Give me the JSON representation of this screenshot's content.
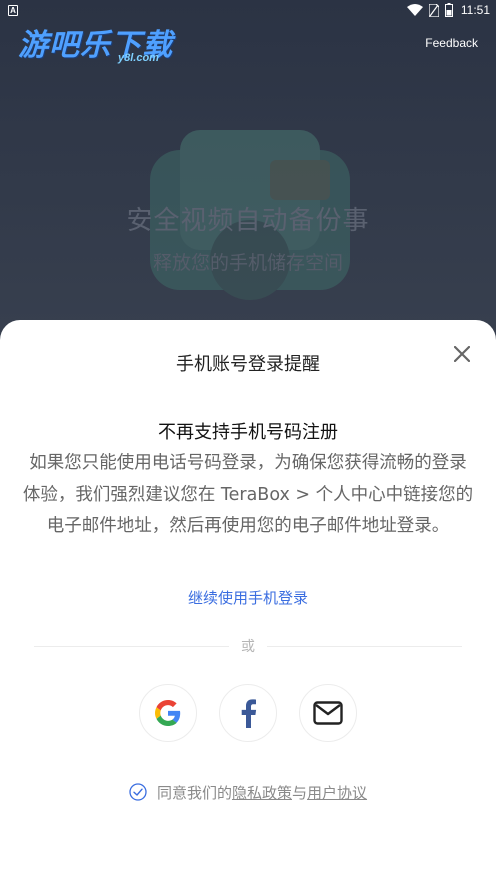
{
  "status_bar": {
    "left_indicator": "A",
    "time": "11:51",
    "icons": [
      "wifi-icon",
      "sim-card-icon",
      "battery-icon"
    ]
  },
  "watermark": {
    "main": "游吧乐下载",
    "sub": "y8l.com"
  },
  "header": {
    "feedback_label": "Feedback"
  },
  "background": {
    "title": "安全视频自动备份事",
    "subtitle": "释放您的手机储存空间"
  },
  "sheet": {
    "title": "手机账号登录提醒",
    "close_icon": "close-icon",
    "notice_heading": "不再支持手机号码注册",
    "notice_body": "如果您只能使用电话号码登录，为确保您获得流畅的登录体验，我们强烈建议您在 TeraBox > 个人中心中链接您的电子邮件地址，然后再使用您的电子邮件地址登录。",
    "phone_login_link": "继续使用手机登录",
    "divider_text": "或",
    "social_buttons": [
      {
        "icon": "google-icon"
      },
      {
        "icon": "facebook-icon"
      },
      {
        "icon": "email-icon"
      }
    ],
    "agreement": {
      "prefix": "同意我们的",
      "privacy_policy": "隐私政策",
      "conjunction": "与",
      "user_agreement": "用户协议",
      "checked": true
    }
  },
  "colors": {
    "accent_link": "#3a6de0",
    "background_dark": "#2d3546",
    "sheet_bg": "#ffffff"
  }
}
